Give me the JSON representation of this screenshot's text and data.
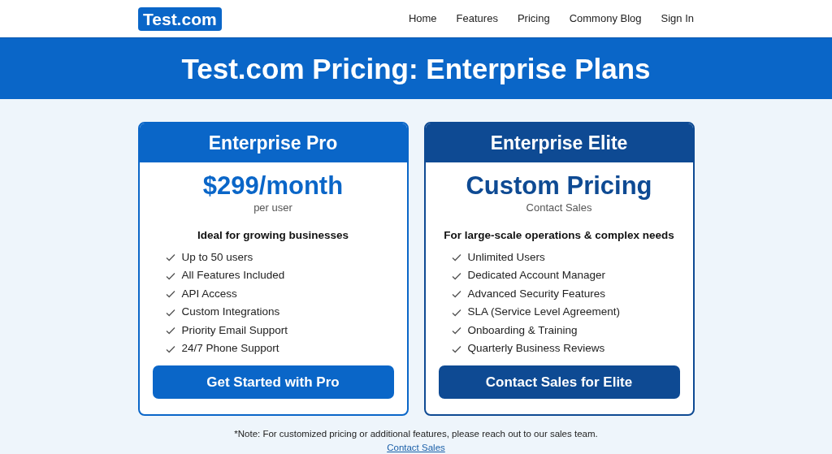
{
  "navbar": {
    "logo": "Test.com",
    "links": [
      "Home",
      "Features",
      "Pricing",
      "Commony Blog",
      "Sign In"
    ]
  },
  "banner": {
    "title": "Test.com Pricing: Enterprise Plans"
  },
  "plans": [
    {
      "name": "Enterprise Pro",
      "color": "#0a66c8",
      "price": "$299/month",
      "price_note": "per user",
      "tagline": "Ideal for growing businesses",
      "features": [
        "Up to 50 users",
        "All Features Included",
        "API Access",
        "Custom Integrations",
        "Priority Email Support",
        "24/7 Phone Support"
      ],
      "button": "Get Started with Pro"
    },
    {
      "name": "Enterprise Elite",
      "color": "#0e4a93",
      "price": "Custom Pricing",
      "price_note": "Contact Sales",
      "tagline": "For large-scale operations & complex needs",
      "features": [
        "Unlimited Users",
        "Dedicated Account Manager",
        "Advanced Security Features",
        "SLA (Service Level Agreement)",
        "Onboarding & Training",
        "Quarterly Business Reviews"
      ],
      "button": "Contact Sales for Elite"
    }
  ],
  "footer": {
    "note": "*Note: For customized pricing or additional features, please reach out to our sales team.",
    "link": "Contact Sales"
  }
}
